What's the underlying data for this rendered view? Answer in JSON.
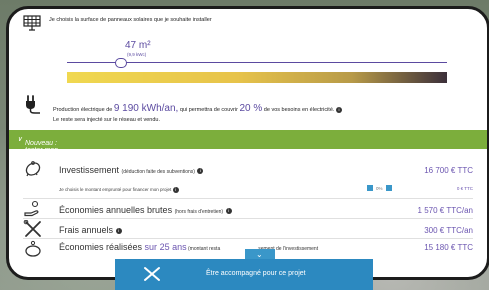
{
  "surface": {
    "description": "Je choisis la surface de panneaux solaires que je souhaite installer",
    "area_value": "47 m²",
    "area_sub": "(9,9 kWc)",
    "slider_level": 0.14
  },
  "production": {
    "prefix": "Production électrique de ",
    "kwh": "9 190 kWh/an,",
    "middle": " qui permettra de couvrir ",
    "percent": "20 %",
    "suffix": " de vos besoins en électricité.",
    "note": "Le reste sera injecté sur le réseau et vendu."
  },
  "new_section": {
    "label": "Nouveau : tester mon raccordement électrique"
  },
  "investment": {
    "label": "Investissement",
    "sub": "(déduction faite des subventions)",
    "value": "16 700 € TTC",
    "loan_text": "Je choisis le montant emprunté pour financer mon projet",
    "percent": "0%",
    "loan_value": "0 € TTC"
  },
  "savings": {
    "label": "Économies annuelles brutes",
    "sub": "(hors frais d'entretien)",
    "value": "1 570 € TTC/an"
  },
  "fees": {
    "label": "Frais annuels",
    "value": "300 € TTC/an"
  },
  "realized": {
    "label_a": "Économies réalisées ",
    "label_b": "sur ",
    "years": "25 ans",
    "detail_a": " (montant resta",
    "detail_b": "sement de l'investissement",
    "value": "15 180 € TTC"
  },
  "cta": {
    "label": "Être accompagné pour ce projet"
  },
  "colors": {
    "accent": "#5b4aa0",
    "green": "#7cae3c",
    "blue": "#2c89c0"
  }
}
